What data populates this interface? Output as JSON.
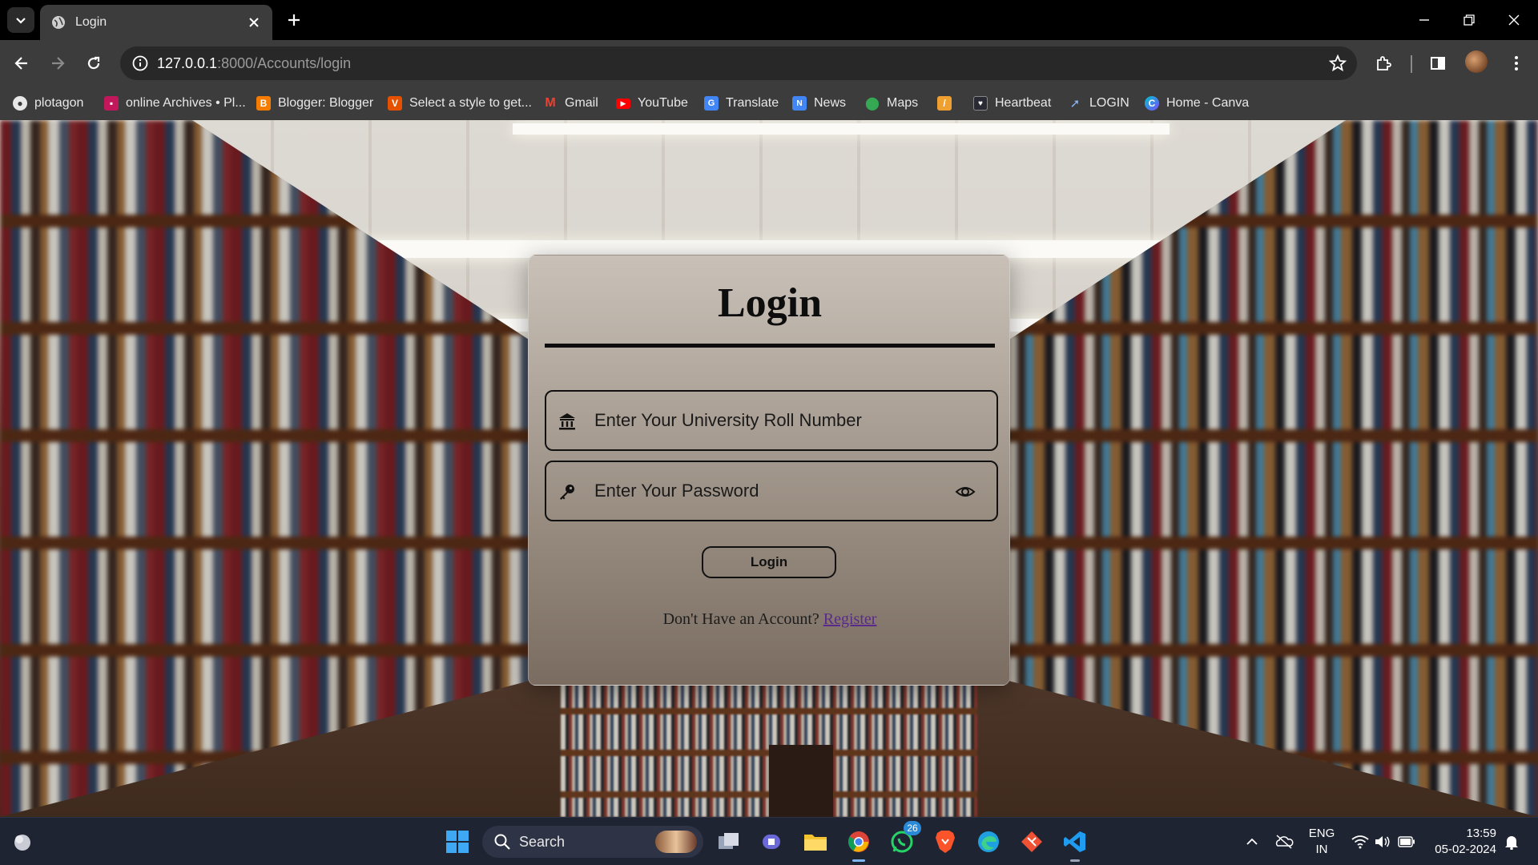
{
  "browser": {
    "tab_title": "Login",
    "url_host": "127.0.0.1",
    "url_rest": ":8000/Accounts/login"
  },
  "bookmarks": [
    {
      "label": "plotagon",
      "icon": "globe-icon",
      "color": "#e8e8e8"
    },
    {
      "label": "online Archives • Pl...",
      "icon": "archive-icon",
      "color": "#c2185b"
    },
    {
      "label": "Blogger: Blogger",
      "icon": "blogger-icon",
      "color": "#f57c00"
    },
    {
      "label": "Select a style to get...",
      "icon": "v-icon",
      "color": "#e65100"
    },
    {
      "label": "Gmail",
      "icon": "gmail-icon",
      "color": "#ea4335"
    },
    {
      "label": "YouTube",
      "icon": "youtube-icon",
      "color": "#ff0000"
    },
    {
      "label": "Translate",
      "icon": "translate-icon",
      "color": "#4285f4"
    },
    {
      "label": "News",
      "icon": "news-icon",
      "color": "#4285f4"
    },
    {
      "label": "Maps",
      "icon": "maps-icon",
      "color": "#34a853"
    },
    {
      "label": "",
      "icon": "brush-icon",
      "color": "#f0a030"
    },
    {
      "label": "Heartbeat",
      "icon": "heartbeat-icon",
      "color": "#555555"
    },
    {
      "label": "LOGIN",
      "icon": "rocket-icon",
      "color": "#8ab4f8"
    },
    {
      "label": "Home - Canva",
      "icon": "canva-icon",
      "color": "#7c4dff"
    }
  ],
  "login": {
    "title": "Login",
    "roll_placeholder": "Enter Your University Roll Number",
    "password_placeholder": "Enter Your Password",
    "button_label": "Login",
    "signup_text": "Don't Have an Account?",
    "register_link": "Register"
  },
  "taskbar": {
    "search_label": "Search",
    "whatsapp_badge": "26",
    "lang_line1": "ENG",
    "lang_line2": "IN",
    "time": "13:59",
    "date": "05-02-2024"
  }
}
